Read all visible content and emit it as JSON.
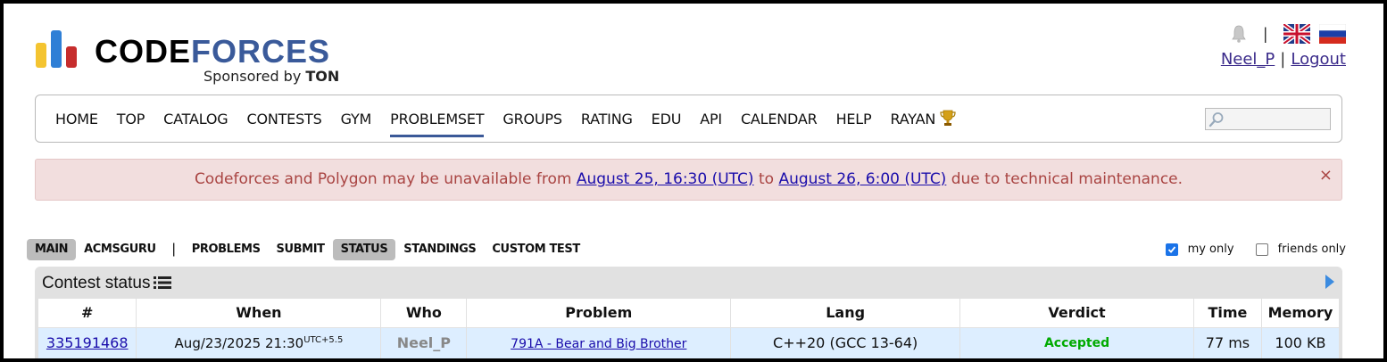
{
  "brand": {
    "name_part1": "CODE",
    "name_part2": "FORCES",
    "sponsor_prefix": "Sponsored by ",
    "sponsor": "TON",
    "colors": {
      "yellow": "#f4c430",
      "blue": "#2f7fd6",
      "red": "#c62d2d",
      "forces": "#3a5a9a"
    }
  },
  "header": {
    "separator": "|",
    "user": "Neel_P",
    "pipe": "|",
    "logout": "Logout",
    "icons": [
      "bell-icon",
      "flag-uk-icon",
      "flag-ru-icon"
    ]
  },
  "nav": {
    "items": [
      "HOME",
      "TOP",
      "CATALOG",
      "CONTESTS",
      "GYM",
      "PROBLEMSET",
      "GROUPS",
      "RATING",
      "EDU",
      "API",
      "CALENDAR",
      "HELP",
      "RAYAN"
    ],
    "active": "PROBLEMSET",
    "search_value": ""
  },
  "alert": {
    "text_before": "Codeforces and Polygon may be unavailable from ",
    "link1": "August 25, 16:30 (UTC)",
    "text_mid": " to ",
    "link2": "August 26, 6:00 (UTC)",
    "text_after": " due to technical maintenance.",
    "close": "×"
  },
  "second_menu": {
    "left": [
      "MAIN",
      "ACMSGURU"
    ],
    "separator": "|",
    "right": [
      "PROBLEMS",
      "SUBMIT",
      "STATUS",
      "STANDINGS",
      "CUSTOM TEST"
    ],
    "selected": [
      "MAIN",
      "STATUS"
    ]
  },
  "filters": {
    "my_only": "my only",
    "my_only_checked": true,
    "friends_only": "friends only",
    "friends_only_checked": false
  },
  "status": {
    "title": "Contest status",
    "columns": [
      "#",
      "When",
      "Who",
      "Problem",
      "Lang",
      "Verdict",
      "Time",
      "Memory"
    ],
    "rows": [
      {
        "id": "335191468",
        "when": "Aug/23/2025 21:30",
        "tz": "UTC+5.5",
        "who": "Neel_P",
        "problem": "791A - Bear and Big Brother",
        "lang": "C++20 (GCC 13-64)",
        "verdict": "Accepted",
        "time": "77 ms",
        "memory": "100 KB"
      }
    ]
  }
}
